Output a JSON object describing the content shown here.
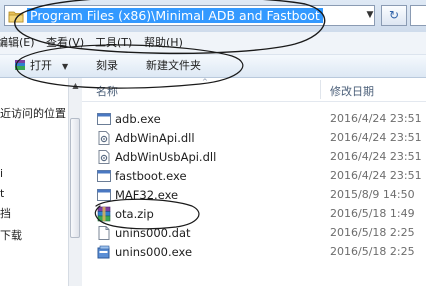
{
  "address_bar": {
    "path": "Program Files (x86)\\Minimal ADB and Fastboot",
    "folder_icon": "folder-icon",
    "dropdown_icon": "chevron-down-icon",
    "refresh_icon": "refresh-icon",
    "refresh_glyph": "↻"
  },
  "menu": [
    {
      "label": "编辑(E)"
    },
    {
      "label": "查看(V)"
    },
    {
      "label": "工具(T)"
    },
    {
      "label": "帮助(H)"
    }
  ],
  "toolbar": {
    "open_label": "打开",
    "open_dropdown": "▼",
    "burn_label": "刻录",
    "new_folder_label": "新建文件夹"
  },
  "nav_pane": {
    "items": [
      {
        "label": "近访问的位置"
      },
      {
        "label": "i"
      },
      {
        "label": "t"
      },
      {
        "label": "挡"
      },
      {
        "label": "下载"
      }
    ]
  },
  "columns": {
    "name": "名称",
    "date_modified": "修改日期",
    "sort_glyph": "^"
  },
  "files": [
    {
      "name": "adb.exe",
      "modified": "2016/4/24 23:51",
      "icon": "exe-icon"
    },
    {
      "name": "AdbWinApi.dll",
      "modified": "2016/4/24 23:51",
      "icon": "dll-icon"
    },
    {
      "name": "AdbWinUsbApi.dll",
      "modified": "2016/4/24 23:51",
      "icon": "dll-icon"
    },
    {
      "name": "fastboot.exe",
      "modified": "2016/4/24 23:51",
      "icon": "exe-icon"
    },
    {
      "name": "MAF32.exe",
      "modified": "2015/8/9 14:50",
      "icon": "exe-icon"
    },
    {
      "name": "ota.zip",
      "modified": "2016/5/18 1:49",
      "icon": "winrar-archive-icon"
    },
    {
      "name": "unins000.dat",
      "modified": "2016/5/18 2:25",
      "icon": "blank-file-icon"
    },
    {
      "name": "unins000.exe",
      "modified": "2016/5/18 2:25",
      "icon": "installer-icon"
    }
  ],
  "colors": {
    "path_highlight": "#3399ff",
    "annotation_ink": "#1a1a1a"
  }
}
